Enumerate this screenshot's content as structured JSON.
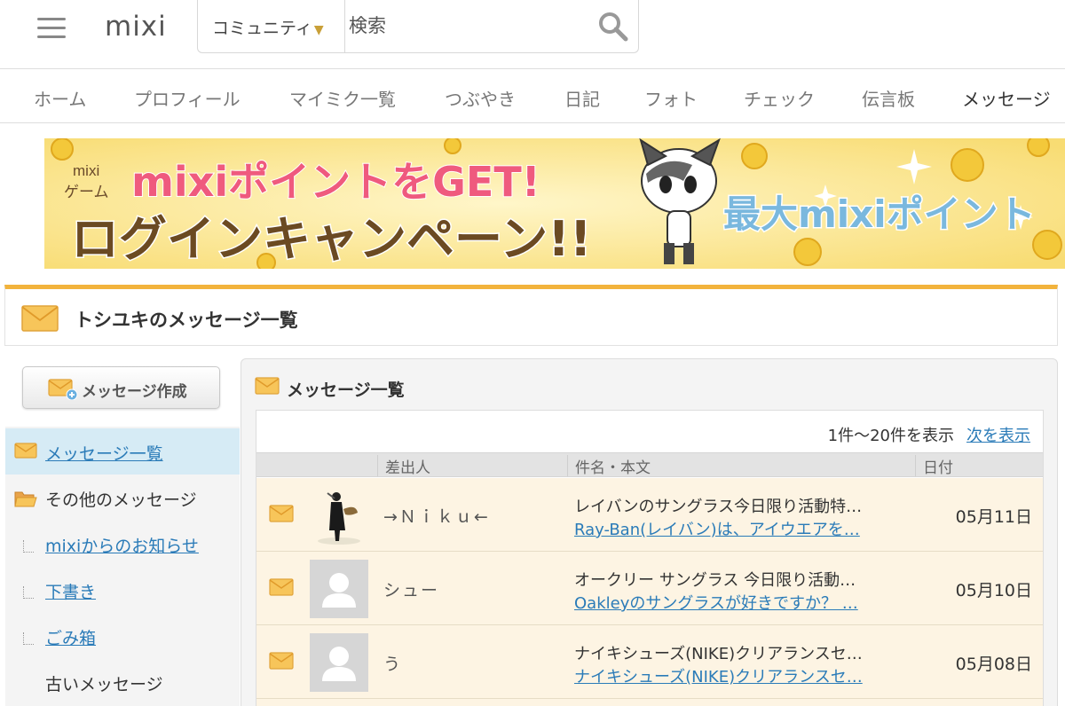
{
  "header": {
    "logo": "mixi",
    "search_category": "コミュニティ",
    "search_placeholder": "検索"
  },
  "nav": {
    "items": [
      {
        "label": "ホーム"
      },
      {
        "label": "プロフィール"
      },
      {
        "label": "マイミク一覧"
      },
      {
        "label": "つぶやき"
      },
      {
        "label": "日記"
      },
      {
        "label": "フォト"
      },
      {
        "label": "チェック"
      },
      {
        "label": "伝言板"
      },
      {
        "label": "メッセージ",
        "active": true
      }
    ]
  },
  "banner": {
    "line1_small": "mixi",
    "line1_small2": "ゲーム",
    "headline": "mixiポイントをGET!",
    "subline": "ログインキャンペーン!!",
    "right_text": "最大mixiポイント"
  },
  "page": {
    "title": "トシユキのメッセージ一覧"
  },
  "sidebar": {
    "compose_label": "メッセージ作成",
    "items": [
      {
        "label": "メッセージ一覧"
      },
      {
        "label": "その他のメッセージ"
      },
      {
        "label": "mixiからのお知らせ"
      },
      {
        "label": "下書き"
      },
      {
        "label": "ごみ箱"
      },
      {
        "label": "古いメッセージ"
      }
    ]
  },
  "main": {
    "title": "メッセージ一覧",
    "pager_text": "1件〜20件を表示",
    "pager_next": "次を表示",
    "columns": [
      "差出人",
      "件名・本文",
      "日付"
    ],
    "rows": [
      {
        "sender": "→Ｎｉｋｕ←",
        "subject": "レイバンのサングラス今日限り活動特…",
        "body": "Ray-Ban(レイバン)は、アイウエアを…",
        "date": "05月11日"
      },
      {
        "sender": "シュー",
        "subject": "オークリー サングラス 今日限り活動…",
        "body": "Oakleyのサングラスが好きですか？ …",
        "date": "05月10日"
      },
      {
        "sender": "う",
        "subject": "ナイキシューズ(NIKE)クリアランスセ…",
        "body": "ナイキシューズ(NIKE)クリアランスセ…",
        "date": "05月08日"
      }
    ]
  },
  "colors": {
    "accent": "#f2b33c",
    "link": "#2a7bb8",
    "row_bg": "#fdf4e3"
  }
}
